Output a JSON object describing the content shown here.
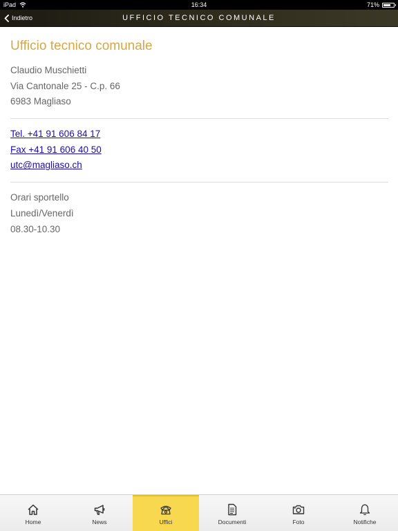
{
  "status_bar": {
    "device": "iPad",
    "time": "16:34",
    "battery": "71%",
    "battery_level": 0.71
  },
  "nav": {
    "back_label": "Indietro",
    "title": "UFFICIO TECNICO COMUNALE"
  },
  "office": {
    "name": "Ufficio tecnico comunale",
    "address": [
      "Claudio Muschietti",
      "Via Cantonale 25 - C.p. 66",
      "6983 Magliaso"
    ],
    "contacts": {
      "phone": "Tel. +41 91 606 84 17",
      "fax": "Fax +41 91 606 40 50",
      "email": "utc@magliaso.ch"
    },
    "hours": [
      "Orari sportello",
      "Lunedì/Venerdì",
      "08.30-10.30"
    ]
  },
  "colors": {
    "title_accent": "#d4a74b",
    "active_tab": "#f7d84e",
    "link": "#1a0dab"
  },
  "tabs": [
    {
      "label": "Home",
      "icon": "home-icon"
    },
    {
      "label": "News",
      "icon": "megaphone-icon"
    },
    {
      "label": "Uffici",
      "icon": "telephone-icon",
      "active": true
    },
    {
      "label": "Documenti",
      "icon": "document-icon"
    },
    {
      "label": "Foto",
      "icon": "camera-icon"
    },
    {
      "label": "Notifiche",
      "icon": "bell-icon"
    }
  ]
}
